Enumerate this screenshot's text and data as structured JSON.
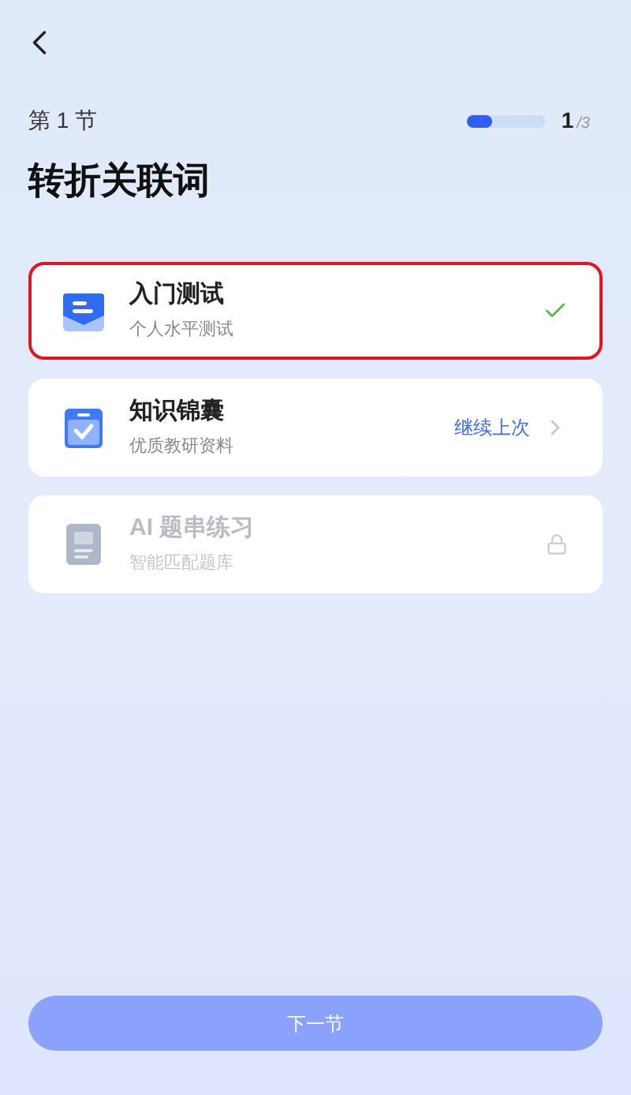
{
  "header": {
    "section": "第 1 节",
    "progress": {
      "level": 0.33,
      "current": "1",
      "total": "/3"
    },
    "title": "转折关联词"
  },
  "items": [
    {
      "kind": "done",
      "title": "入门测试",
      "subtitle": "个人水平测试",
      "highlighted": true
    },
    {
      "kind": "continue",
      "title": "知识锦囊",
      "subtitle": "优质教研资料",
      "action": "继续上次",
      "highlighted": false
    },
    {
      "kind": "locked",
      "title": "AI 题串练习",
      "subtitle": "智能匹配题库",
      "highlighted": false
    }
  ],
  "next_button": {
    "label": "下一节",
    "disabled": true
  }
}
